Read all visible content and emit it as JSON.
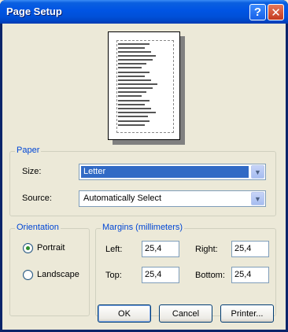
{
  "window": {
    "title": "Page Setup",
    "help_glyph": "?",
    "close_glyph": "✕"
  },
  "paper": {
    "legend": "Paper",
    "size_label": "Size:",
    "size_value": "Letter",
    "source_label": "Source:",
    "source_value": "Automatically Select"
  },
  "orientation": {
    "legend": "Orientation",
    "portrait_label": "Portrait",
    "landscape_label": "Landscape",
    "selected": "Portrait"
  },
  "margins": {
    "legend": "Margins (millimeters)",
    "left_label": "Left:",
    "left_value": "25,4",
    "right_label": "Right:",
    "right_value": "25,4",
    "top_label": "Top:",
    "top_value": "25,4",
    "bottom_label": "Bottom:",
    "bottom_value": "25,4"
  },
  "buttons": {
    "ok": "OK",
    "cancel": "Cancel",
    "printer": "Printer..."
  },
  "colors": {
    "accent": "#0054e3",
    "legend": "#0046d5",
    "selection": "#316ac5"
  },
  "icons": {
    "help": "help-icon",
    "close": "close-icon",
    "dropdown": "chevron-down-icon"
  }
}
